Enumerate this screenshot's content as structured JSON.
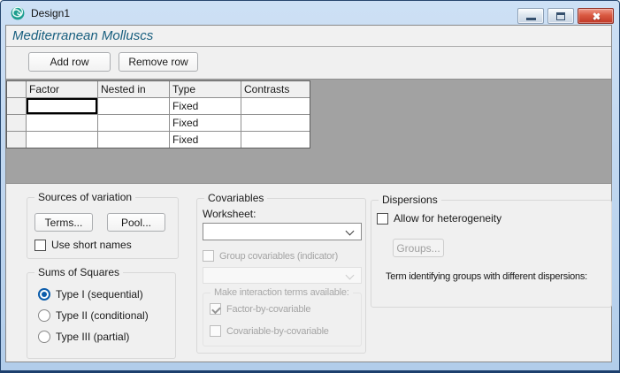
{
  "window": {
    "title": "Design1",
    "icon": "spiral-logo-icon",
    "controls": {
      "minimize": "minimize-icon",
      "maximize": "maximize-icon",
      "close": "close-icon"
    }
  },
  "header": {
    "title": "Mediterranean Molluscs"
  },
  "toolbar": {
    "add_row_label": "Add row",
    "remove_row_label": "Remove row"
  },
  "grid": {
    "columns": [
      "Factor",
      "Nested in",
      "Type",
      "Contrasts"
    ],
    "rows": [
      {
        "factor": "",
        "nested_in": "",
        "type": "Fixed",
        "contrasts": ""
      },
      {
        "factor": "",
        "nested_in": "",
        "type": "Fixed",
        "contrasts": ""
      },
      {
        "factor": "",
        "nested_in": "",
        "type": "Fixed",
        "contrasts": ""
      }
    ],
    "selected_cell": {
      "row": 0,
      "column": "Factor"
    }
  },
  "sources_of_variation": {
    "title": "Sources of variation",
    "terms_label": "Terms...",
    "pool_label": "Pool...",
    "use_short_names": {
      "label": "Use short names",
      "checked": false
    }
  },
  "sums_of_squares": {
    "title": "Sums of Squares",
    "options": [
      {
        "label": "Type I (sequential)",
        "selected": true
      },
      {
        "label": "Type II (conditional)",
        "selected": false
      },
      {
        "label": "Type III (partial)",
        "selected": false
      }
    ]
  },
  "covariables": {
    "title": "Covariables",
    "worksheet_label": "Worksheet:",
    "worksheet_value": "",
    "group_covariables": {
      "label": "Group covariables (indicator)",
      "checked": false,
      "enabled": false
    },
    "interaction": {
      "title": "Make interaction terms available:",
      "enabled": false,
      "factor_by_covariable": {
        "label": "Factor-by-covariable",
        "checked": true,
        "enabled": false
      },
      "covariable_by_covariable": {
        "label": "Covariable-by-covariable",
        "checked": false,
        "enabled": false
      }
    }
  },
  "dispersions": {
    "title": "Dispersions",
    "allow_heterogeneity": {
      "label": "Allow for heterogeneity",
      "checked": false
    },
    "groups_label": "Groups...",
    "groups_enabled": false,
    "term_label": "Term identifying groups with different dispersions:"
  },
  "colors": {
    "titlebar_blue": "#bdd6f0",
    "frame_border": "#26466e",
    "heading_text": "#175e7e",
    "grid_background": "#a2a2a2",
    "accent_blue": "#0b5cab",
    "close_button_red": "#ce4435"
  }
}
